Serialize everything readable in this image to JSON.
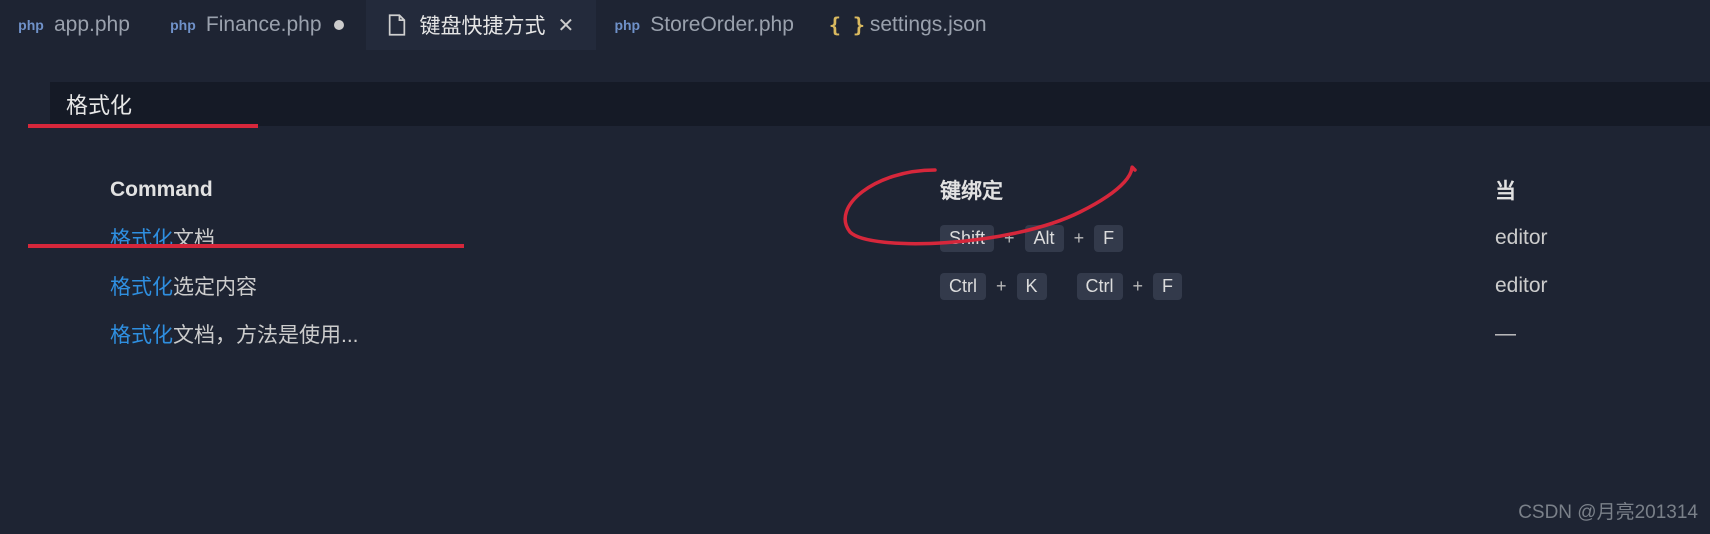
{
  "tabs": [
    {
      "label": "app.php",
      "icon": "php",
      "dirty": false,
      "active": false
    },
    {
      "label": "Finance.php",
      "icon": "php",
      "dirty": true,
      "active": false
    },
    {
      "label": "键盘快捷方式",
      "icon": "doc",
      "dirty": false,
      "active": true
    },
    {
      "label": "StoreOrder.php",
      "icon": "php",
      "dirty": false,
      "active": false
    },
    {
      "label": "settings.json",
      "icon": "json",
      "dirty": false,
      "active": false
    }
  ],
  "search": {
    "value": "格式化"
  },
  "headers": {
    "command": "Command",
    "keybinding": "键绑定",
    "when": "当"
  },
  "rows": [
    {
      "cmd_hl": "格式化",
      "cmd_rest": "文档",
      "keys": [
        [
          "Shift",
          "Alt",
          "F"
        ]
      ],
      "when": "editor"
    },
    {
      "cmd_hl": "格式化",
      "cmd_rest": "选定内容",
      "keys": [
        [
          "Ctrl",
          "K"
        ],
        [
          "Ctrl",
          "F"
        ]
      ],
      "when": "editor"
    },
    {
      "cmd_hl": "格式化",
      "cmd_rest": "文档，方法是使用...",
      "keys": [],
      "when": "—"
    }
  ],
  "watermark": "CSDN @月亮201314"
}
